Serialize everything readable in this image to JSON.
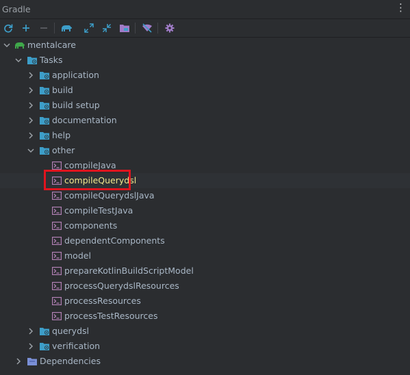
{
  "panel": {
    "title": "Gradle",
    "more_icon": "more-vertical-icon"
  },
  "toolbar": {
    "buttons": [
      {
        "name": "reload-button",
        "icon": "refresh-icon"
      },
      {
        "name": "add-button",
        "icon": "plus-icon"
      },
      {
        "name": "remove-button",
        "icon": "minus-icon"
      },
      {
        "name": "execute-task-button",
        "icon": "gradle-elephant-icon"
      },
      {
        "name": "expand-all-button",
        "icon": "expand-icon"
      },
      {
        "name": "collapse-all-button",
        "icon": "collapse-icon"
      },
      {
        "name": "group-modules-button",
        "icon": "folder-icon"
      },
      {
        "name": "toggle-offline-button",
        "icon": "offline-icon"
      },
      {
        "name": "settings-button",
        "icon": "gear-icon"
      }
    ]
  },
  "tree": {
    "root": "mentalcare",
    "tasks_label": "Tasks",
    "groups_before": [
      "application",
      "build",
      "build setup",
      "documentation",
      "help"
    ],
    "other_label": "other",
    "other_tasks": [
      "compileJava",
      "compileQuerydsl",
      "compileQuerydslJava",
      "compileTestJava",
      "components",
      "dependentComponents",
      "model",
      "prepareKotlinBuildScriptModel",
      "processQuerydslResources",
      "processResources",
      "processTestResources"
    ],
    "groups_after": [
      "querydsl",
      "verification"
    ],
    "dependencies_label": "Dependencies",
    "selected_task": "compileQuerydsl"
  },
  "colors": {
    "background": "#2b2d30",
    "selection_row": "#2e3135",
    "highlight_box": "#e0141e",
    "highlight_text": "#f0e68c",
    "gradle_green": "#3fa84a",
    "folder_blue": "#3d9ec9",
    "task_purple": "#b07fb3"
  }
}
